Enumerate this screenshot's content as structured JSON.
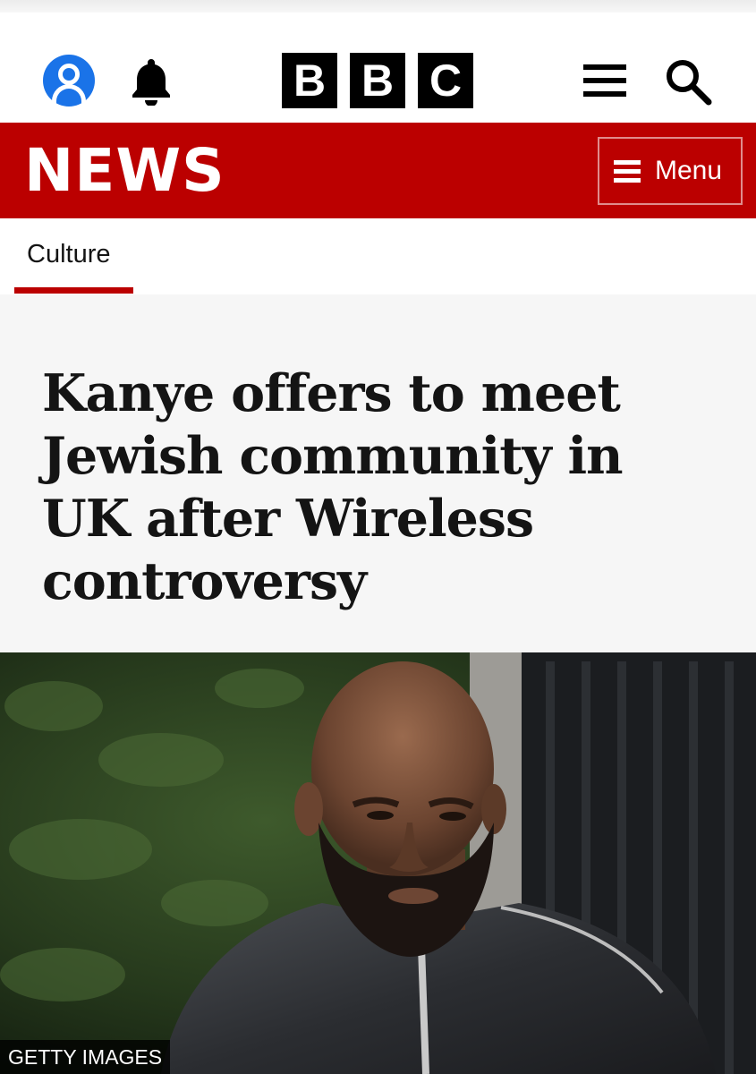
{
  "masthead": {
    "logo_letters": [
      "B",
      "B",
      "C"
    ],
    "icons": {
      "account": "account-icon",
      "notifications": "bell-icon",
      "more": "hamburger-icon",
      "search": "search-icon"
    }
  },
  "news_bar": {
    "title": "NEWS",
    "menu_label": "Menu",
    "color": "#bb0000"
  },
  "section_nav": {
    "active_section": "Culture"
  },
  "article": {
    "headline": "Kanye offers to meet Jewish community in UK after Wireless controversy",
    "image_credit": "GETTY IMAGES"
  }
}
